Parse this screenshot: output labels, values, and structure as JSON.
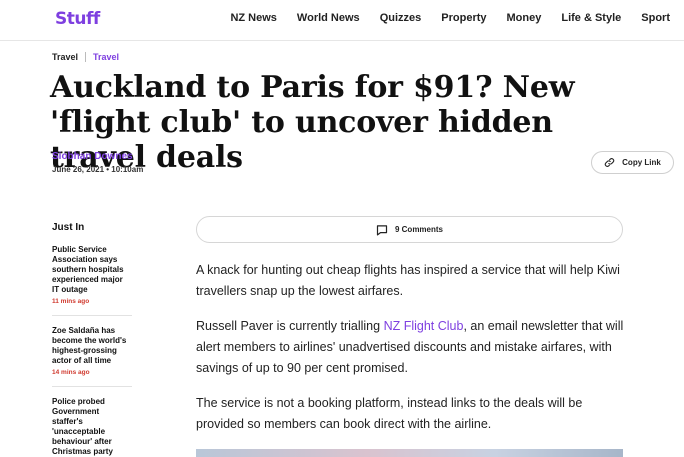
{
  "header": {
    "logo": "Stuff",
    "nav": [
      "NZ News",
      "World News",
      "Quizzes",
      "Property",
      "Money",
      "Life & Style",
      "Sport"
    ]
  },
  "breadcrumb": [
    "Travel",
    "Travel"
  ],
  "article": {
    "headline": "Auckland to Paris for $91? New 'flight club' to uncover hidden travel deals",
    "author": "Siobhan Downes",
    "date": "June 26, 2021 • 10:10am",
    "copy_link_label": "Copy Link",
    "comments_label": "9 Comments",
    "p1": "A knack for hunting out cheap flights has inspired a service that will help Kiwi travellers snap up the lowest airfares.",
    "p2_before": "Russell Paver is currently trialling ",
    "p2_link": "NZ Flight Club",
    "p2_after": ", an email newsletter that will alert members to airlines' unadvertised discounts and mistake airfares, with savings of up to 90 per cent promised.",
    "p3": "The service is not a booking platform, instead links to the deals will be provided so members can book direct with the airline."
  },
  "just_in": {
    "title": "Just In",
    "items": [
      {
        "headline": "Public Service Association says southern hospitals experienced major IT outage",
        "time": "11 mins ago"
      },
      {
        "headline": "Zoe Saldaña has become the world's highest-grossing actor of all time",
        "time": "14 mins ago"
      },
      {
        "headline": "Police probed Government staffer's 'unacceptable behaviour' after Christmas party",
        "time": ""
      }
    ]
  },
  "colors": {
    "brand": "#7e3fe0",
    "time": "#d03a2f"
  },
  "icons": {
    "copy_link": "link-icon",
    "comments": "comment-icon"
  }
}
